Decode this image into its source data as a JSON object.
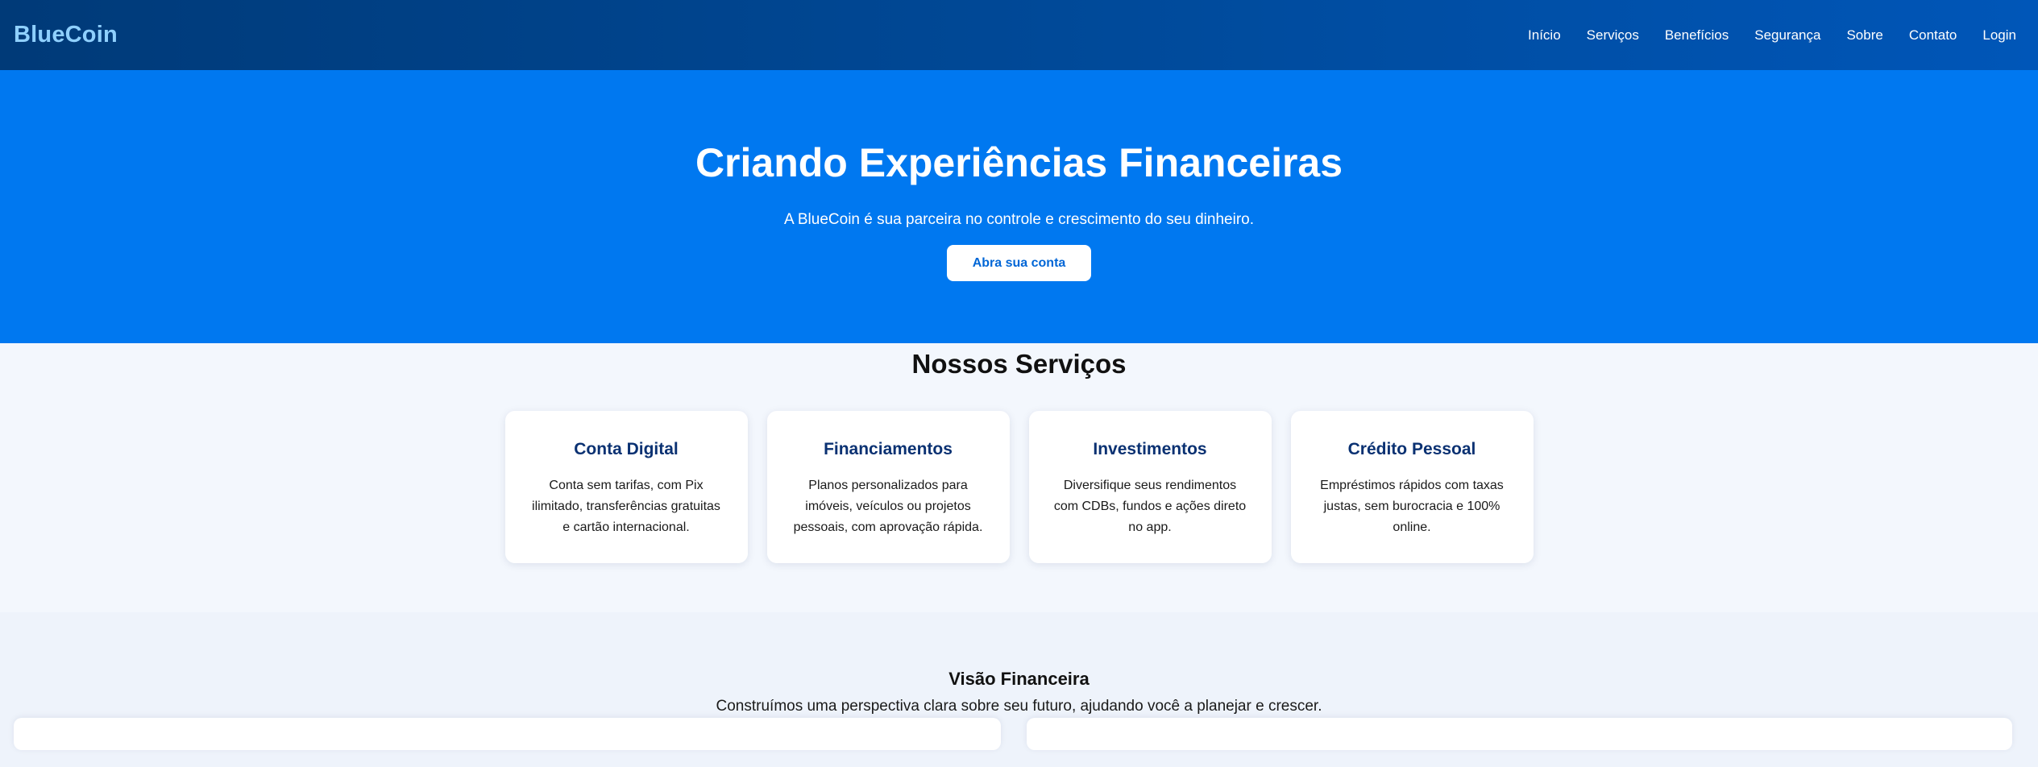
{
  "header": {
    "brand": "BlueCoin",
    "nav": [
      "Início",
      "Serviços",
      "Benefícios",
      "Segurança",
      "Sobre",
      "Contato",
      "Login"
    ]
  },
  "hero": {
    "title": "Criando Experiências Financeiras",
    "subtitle": "A BlueCoin é sua parceira no controle e crescimento do seu dinheiro.",
    "cta": "Abra sua conta"
  },
  "services": {
    "title": "Nossos Serviços",
    "cards": [
      {
        "title": "Conta Digital",
        "text": "Conta sem tarifas, com Pix ilimitado, transferências gratuitas e cartão internacional."
      },
      {
        "title": "Financiamentos",
        "text": "Planos personalizados para imóveis, veículos ou projetos pessoais, com aprovação rápida."
      },
      {
        "title": "Investimentos",
        "text": "Diversifique seus rendimentos com CDBs, fundos e ações direto no app."
      },
      {
        "title": "Crédito Pessoal",
        "text": "Empréstimos rápidos com taxas justas, sem burocracia e 100% online."
      }
    ]
  },
  "vision": {
    "title": "Visão Financeira",
    "subtitle": "Construímos uma perspectiva clara sobre seu futuro, ajudando você a planejar e crescer."
  },
  "colors": {
    "nav_start": "#003a78",
    "nav_end": "#0056b8",
    "brand": "#8fd0ff",
    "hero_bg": "#0078f0",
    "card_title": "#0a3172",
    "cta_text": "#0066d6"
  }
}
